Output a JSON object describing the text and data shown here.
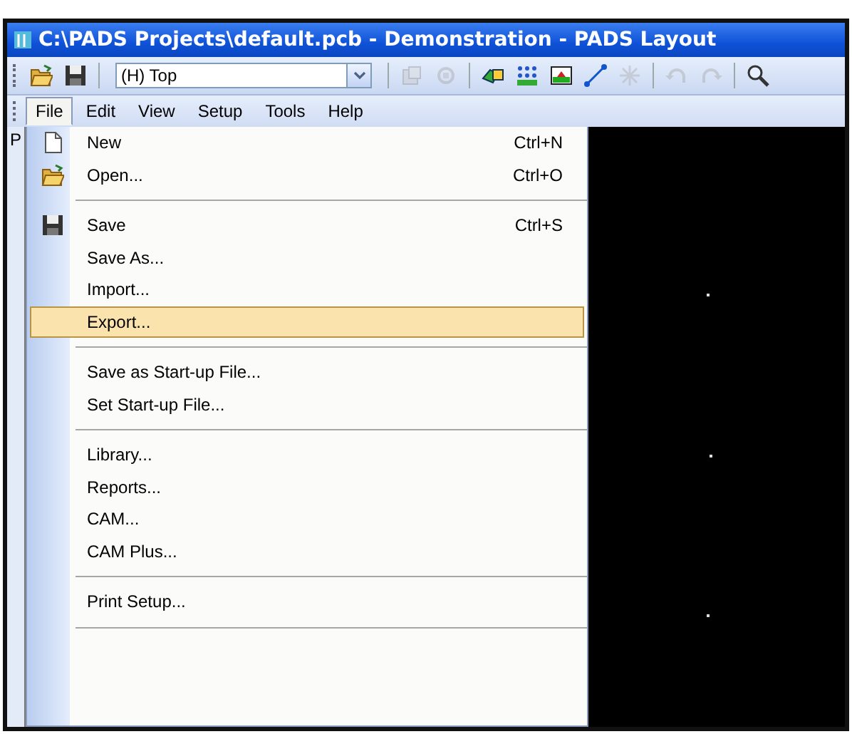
{
  "window": {
    "title": "C:\\PADS Projects\\default.pcb - Demonstration - PADS Layout"
  },
  "toolbar": {
    "buttons": [
      {
        "kind": "open",
        "disabled": false
      },
      {
        "kind": "save",
        "disabled": false
      }
    ],
    "layer": {
      "value": "(H) Top"
    },
    "tools": [
      {
        "kind": "component",
        "disabled": true
      },
      {
        "kind": "rotate",
        "disabled": true
      },
      {
        "kind": "shapes",
        "disabled": false
      },
      {
        "kind": "grid",
        "disabled": false
      },
      {
        "kind": "board",
        "disabled": false
      },
      {
        "kind": "route",
        "disabled": false
      },
      {
        "kind": "spark",
        "disabled": true
      },
      {
        "kind": "undo",
        "disabled": true
      },
      {
        "kind": "redo",
        "disabled": true
      },
      {
        "kind": "search",
        "disabled": false
      }
    ]
  },
  "menubar": [
    {
      "label": "File",
      "selected": true
    },
    {
      "label": "Edit",
      "selected": false
    },
    {
      "label": "View",
      "selected": false
    },
    {
      "label": "Setup",
      "selected": false
    },
    {
      "label": "Tools",
      "selected": false
    },
    {
      "label": "Help",
      "selected": false
    }
  ],
  "side_panel": {
    "label": "P"
  },
  "file_menu": [
    {
      "kind": "new",
      "label": "New",
      "shortcut": "Ctrl+N",
      "selected": false
    },
    {
      "kind": "open",
      "label": "Open...",
      "shortcut": "Ctrl+O",
      "selected": false
    },
    {
      "kind": "separator"
    },
    {
      "kind": "save",
      "label": "Save",
      "shortcut": "Ctrl+S",
      "selected": false
    },
    {
      "kind": "item",
      "label": "Save As...",
      "selected": false
    },
    {
      "kind": "item",
      "label": "Import...",
      "selected": false
    },
    {
      "kind": "item",
      "label": "Export...",
      "selected": true
    },
    {
      "kind": "separator"
    },
    {
      "kind": "item",
      "label": "Save as Start-up File...",
      "selected": false
    },
    {
      "kind": "item",
      "label": "Set Start-up File...",
      "selected": false
    },
    {
      "kind": "separator"
    },
    {
      "kind": "item",
      "label": "Library...",
      "selected": false
    },
    {
      "kind": "item",
      "label": "Reports...",
      "selected": false
    },
    {
      "kind": "item",
      "label": "CAM...",
      "selected": false
    },
    {
      "kind": "item",
      "label": "CAM Plus...",
      "selected": false
    },
    {
      "kind": "separator"
    },
    {
      "kind": "item",
      "label": "Print Setup...",
      "selected": false
    },
    {
      "kind": "separator"
    }
  ]
}
